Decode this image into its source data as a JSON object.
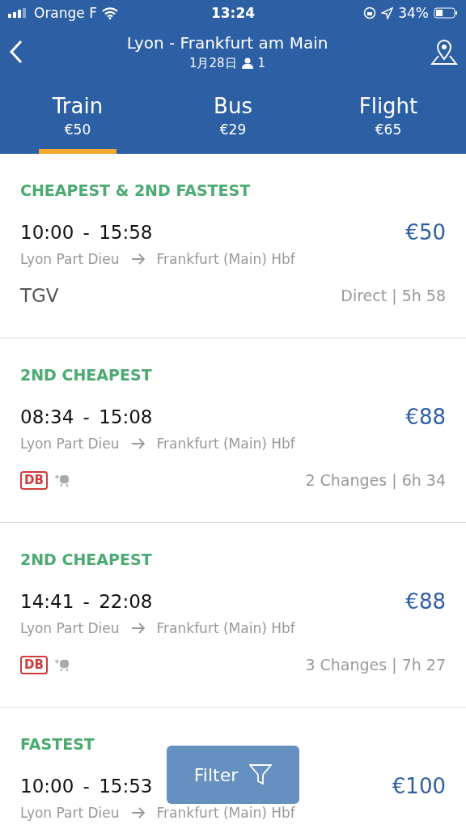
{
  "status_bar": {
    "carrier": "Orange F",
    "time": "13:24",
    "battery": "34%"
  },
  "header": {
    "title": "Lyon - Frankfurt am Main",
    "date": "1月28日",
    "passengers": "1"
  },
  "tabs": [
    {
      "label": "Train",
      "price": "€50",
      "selected": true
    },
    {
      "label": "Bus",
      "price": "€29",
      "selected": false
    },
    {
      "label": "Flight",
      "price": "€65",
      "selected": false
    }
  ],
  "results": [
    {
      "tag": "CHEAPEST & 2ND FASTEST",
      "times": "10:00 - 15:58",
      "price": "€50",
      "from": "Lyon Part Dieu",
      "to": "Frankfurt (Main) Hbf",
      "operator": {
        "kind": "name",
        "label": "TGV"
      },
      "summary": "Direct | 5h 58"
    },
    {
      "tag": "2ND CHEAPEST",
      "times": "08:34 - 15:08",
      "price": "€88",
      "from": "Lyon Part Dieu",
      "to": "Frankfurt (Main) Hbf",
      "operator": {
        "kind": "logo",
        "label": "DB"
      },
      "summary": "2 Changes | 6h 34"
    },
    {
      "tag": "2ND CHEAPEST",
      "times": "14:41 - 22:08",
      "price": "€88",
      "from": "Lyon Part Dieu",
      "to": "Frankfurt (Main) Hbf",
      "operator": {
        "kind": "logo",
        "label": "DB"
      },
      "summary": "3 Changes | 7h 27"
    },
    {
      "tag": "FASTEST",
      "times": "10:00 - 15:53",
      "price": "€100",
      "from": "Lyon Part Dieu",
      "to": "Frankfurt (Main) Hbf"
    }
  ],
  "filter_button": {
    "label": "Filter"
  }
}
